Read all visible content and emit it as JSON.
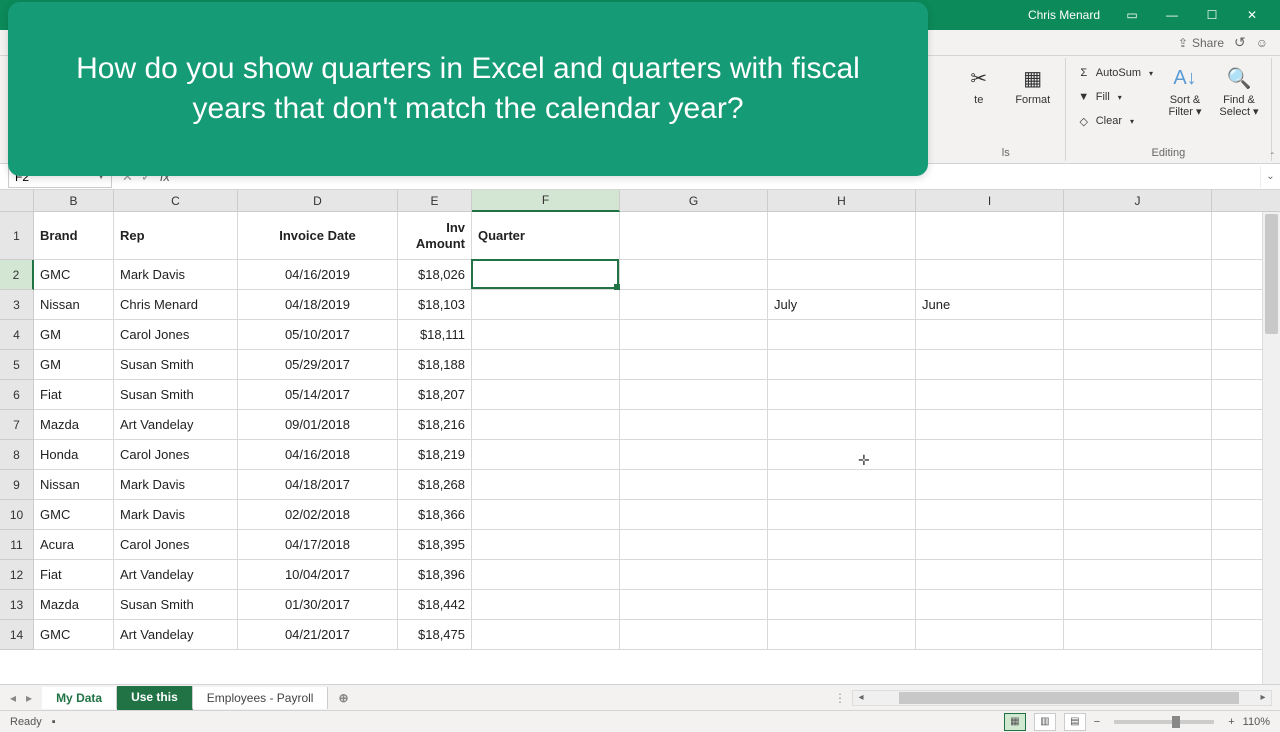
{
  "title_user": "Chris Menard",
  "share_label": "Share",
  "ribbon": {
    "delete": "te",
    "format": "Format",
    "cells_group": "ls",
    "autosum": "AutoSum",
    "fill": "Fill",
    "clear": "Clear",
    "sort": "Sort &",
    "filter": "Filter",
    "find": "Find &",
    "select": "Select",
    "editing_group": "Editing"
  },
  "overlay_text": "How do you show quarters in Excel and quarters with fiscal years that don't match the calendar year?",
  "namebox": "F2",
  "columns": [
    "B",
    "C",
    "D",
    "E",
    "F",
    "G",
    "H",
    "I",
    "J"
  ],
  "headers": {
    "brand": "Brand",
    "rep": "Rep",
    "invdate": "Invoice Date",
    "inv1": "Inv",
    "inv2": "Amount",
    "quarter": "Quarter"
  },
  "rows": [
    {
      "n": "2",
      "brand": "GMC",
      "rep": "Mark Davis",
      "date": "04/16/2019",
      "amt": "$18,026"
    },
    {
      "n": "3",
      "brand": "Nissan",
      "rep": "Chris Menard",
      "date": "04/18/2019",
      "amt": "$18,103",
      "h": "July",
      "i": "June"
    },
    {
      "n": "4",
      "brand": "GM",
      "rep": "Carol Jones",
      "date": "05/10/2017",
      "amt": "$18,111"
    },
    {
      "n": "5",
      "brand": "GM",
      "rep": "Susan Smith",
      "date": "05/29/2017",
      "amt": "$18,188"
    },
    {
      "n": "6",
      "brand": "Fiat",
      "rep": "Susan Smith",
      "date": "05/14/2017",
      "amt": "$18,207"
    },
    {
      "n": "7",
      "brand": "Mazda",
      "rep": "Art Vandelay",
      "date": "09/01/2018",
      "amt": "$18,216"
    },
    {
      "n": "8",
      "brand": "Honda",
      "rep": "Carol Jones",
      "date": "04/16/2018",
      "amt": "$18,219"
    },
    {
      "n": "9",
      "brand": "Nissan",
      "rep": "Mark Davis",
      "date": "04/18/2017",
      "amt": "$18,268"
    },
    {
      "n": "10",
      "brand": "GMC",
      "rep": "Mark Davis",
      "date": "02/02/2018",
      "amt": "$18,366"
    },
    {
      "n": "11",
      "brand": "Acura",
      "rep": "Carol Jones",
      "date": "04/17/2018",
      "amt": "$18,395"
    },
    {
      "n": "12",
      "brand": "Fiat",
      "rep": "Art Vandelay",
      "date": "10/04/2017",
      "amt": "$18,396"
    },
    {
      "n": "13",
      "brand": "Mazda",
      "rep": "Susan Smith",
      "date": "01/30/2017",
      "amt": "$18,442"
    },
    {
      "n": "14",
      "brand": "GMC",
      "rep": "Art Vandelay",
      "date": "04/21/2017",
      "amt": "$18,475"
    }
  ],
  "tabs": {
    "t1": "My Data",
    "t2": "Use this",
    "t3": "Employees - Payroll",
    "add": "⊕"
  },
  "status": {
    "ready": "Ready",
    "zoom": "110%",
    "minus": "−",
    "plus": "+"
  }
}
